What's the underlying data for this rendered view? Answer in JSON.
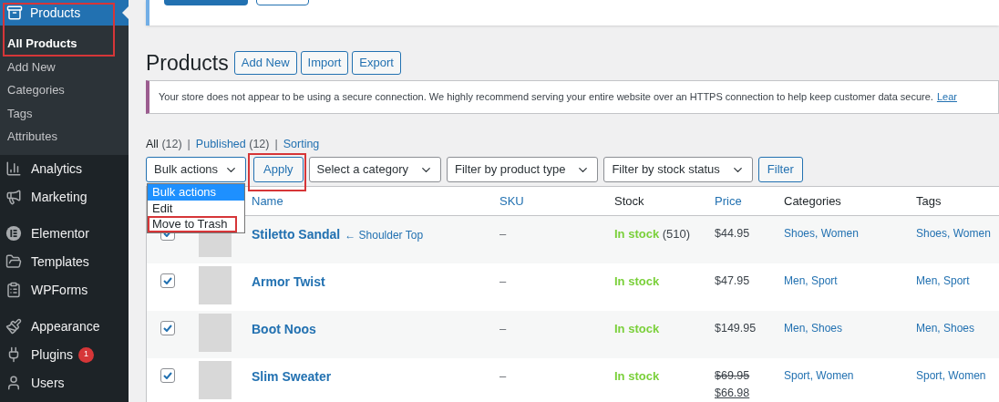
{
  "sidebar": {
    "active_menu": {
      "label": "Products",
      "highlighted": true,
      "submenu": [
        {
          "label": "All Products",
          "selected": true
        },
        {
          "label": "Add New",
          "selected": false
        },
        {
          "label": "Categories",
          "selected": false
        },
        {
          "label": "Tags",
          "selected": false
        },
        {
          "label": "Attributes",
          "selected": false
        }
      ]
    },
    "groups": [
      [
        {
          "label": "Analytics"
        },
        {
          "label": "Marketing"
        }
      ],
      [
        {
          "label": "Elementor"
        },
        {
          "label": "Templates"
        },
        {
          "label": "WPForms"
        }
      ],
      [
        {
          "label": "Appearance"
        },
        {
          "label": "Plugins",
          "badge": "1"
        },
        {
          "label": "Users"
        }
      ]
    ]
  },
  "page": {
    "title": "Products",
    "actions": [
      "Add New",
      "Import",
      "Export"
    ]
  },
  "notice": {
    "text": "Your store does not appear to be using a secure connection. We highly recommend serving your entire website over an HTTPS connection to help keep customer data secure.",
    "link": "Lear"
  },
  "view_separator": "|",
  "views": [
    {
      "label": "All",
      "count": "(12)",
      "selected": true
    },
    {
      "label": "Published",
      "count": "(12)",
      "selected": false
    },
    {
      "label": "Sorting",
      "selected": false
    }
  ],
  "bulk_actions": {
    "value": "Bulk actions",
    "expanded": true,
    "options": [
      {
        "label": "Bulk actions",
        "selected": true,
        "highlighted": false
      },
      {
        "label": "Edit",
        "selected": false,
        "highlighted": false
      },
      {
        "label": "Move to Trash",
        "selected": false,
        "highlighted": true
      }
    ]
  },
  "apply": {
    "label": "Apply",
    "highlighted": true
  },
  "filters": [
    "Select a category",
    "Filter by product type",
    "Filter by stock status"
  ],
  "filter_button": "Filter",
  "table": {
    "columns": [
      "Name",
      "SKU",
      "Stock",
      "Price",
      "Categories",
      "Tags"
    ],
    "rows": [
      {
        "checked": true,
        "name": "Stiletto Sandal",
        "parent": "← Shoulder Top",
        "sku": "–",
        "stock": "In stock",
        "stock_count": "(510)",
        "price": "$44.95",
        "categories": "Shoes, Women",
        "tags": "Shoes, Women"
      },
      {
        "checked": true,
        "name": "Armor Twist",
        "sku": "–",
        "stock": "In stock",
        "price": "$47.95",
        "categories": "Men, Sport",
        "tags": "Men, Sport"
      },
      {
        "checked": true,
        "name": "Boot Noos",
        "sku": "–",
        "stock": "In stock",
        "price": "$149.95",
        "categories": "Men, Shoes",
        "tags": "Men, Shoes"
      },
      {
        "checked": true,
        "name": "Slim Sweater",
        "sku": "–",
        "stock": "In stock",
        "old_price": "$69.95",
        "price": "$66.98",
        "categories": "Sport, Women",
        "tags": "Sport, Women"
      }
    ]
  }
}
